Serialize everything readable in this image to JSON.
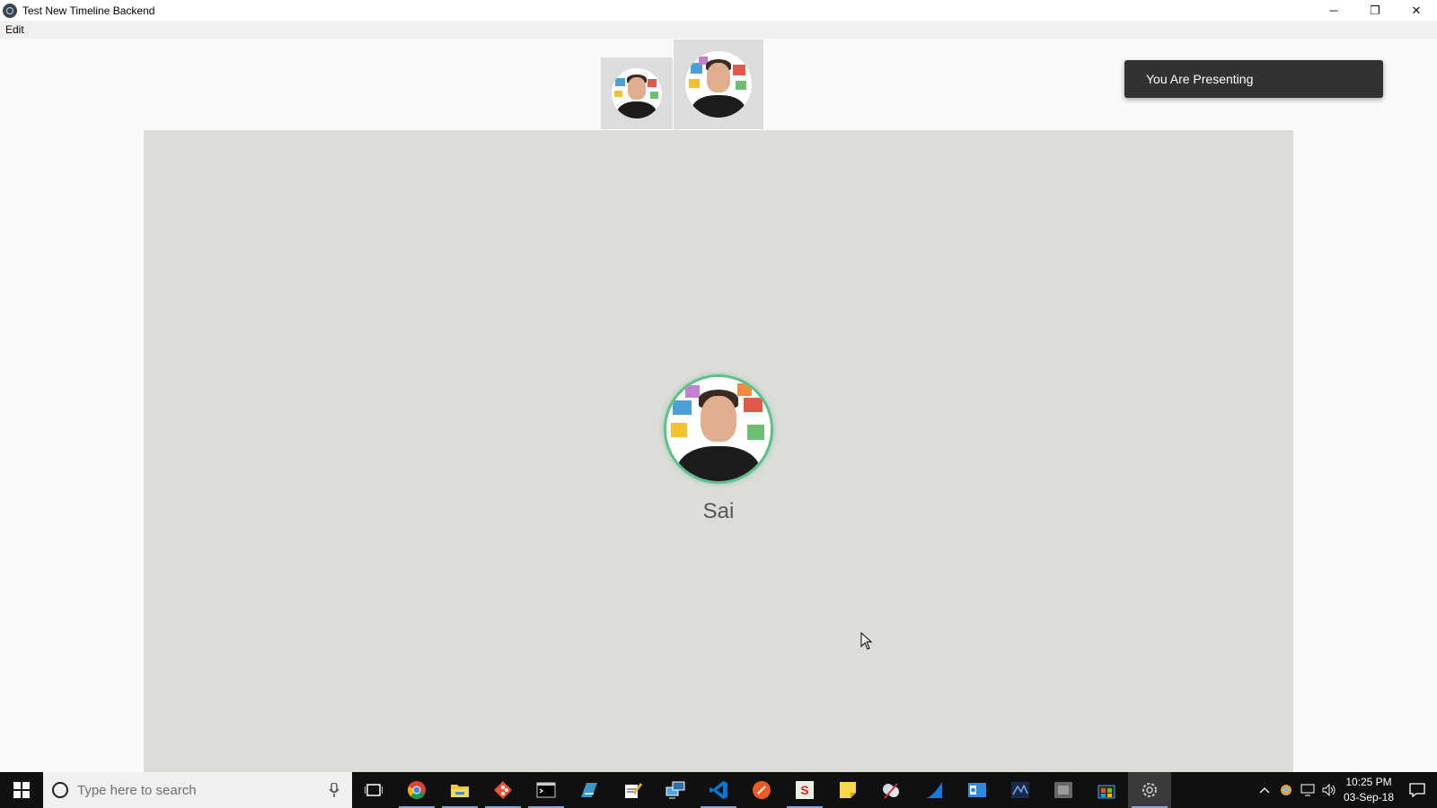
{
  "window": {
    "title": "Test New Timeline Backend",
    "controls": {
      "minimize": "─",
      "restore": "❐",
      "close": "✕"
    }
  },
  "menubar": {
    "items": [
      "Edit"
    ]
  },
  "participants": {
    "thumbnails": [
      {
        "icon": "avatar-photo"
      },
      {
        "icon": "avatar-photo"
      }
    ]
  },
  "toast": {
    "text": "You Are Presenting"
  },
  "stage": {
    "speaker_name": "Sai",
    "speaking_ring_color": "#5cc08a",
    "background_color": "#dcdcd8"
  },
  "taskbar": {
    "search_placeholder": "Type here to search",
    "clock_time": "10:25 PM",
    "clock_date": "03-Sep-18",
    "pinned_icons": [
      "task-view-icon",
      "chrome-icon",
      "file-explorer-icon",
      "git-icon",
      "terminal-icon",
      "azure-data-studio-icon",
      "notepad-icon",
      "remote-desktop-icon",
      "vscode-icon",
      "postman-icon",
      "store-s-icon",
      "sticky-notes-icon",
      "snipping-icon",
      "wireshark-icon",
      "outlook-icon",
      "wave-icon",
      "generic-app-icon",
      "store-icon",
      "settings-app-icon"
    ]
  },
  "colors": {
    "toast_bg": "#323232",
    "taskbar_bg": "#101010",
    "accent": "#7ba9e0"
  }
}
